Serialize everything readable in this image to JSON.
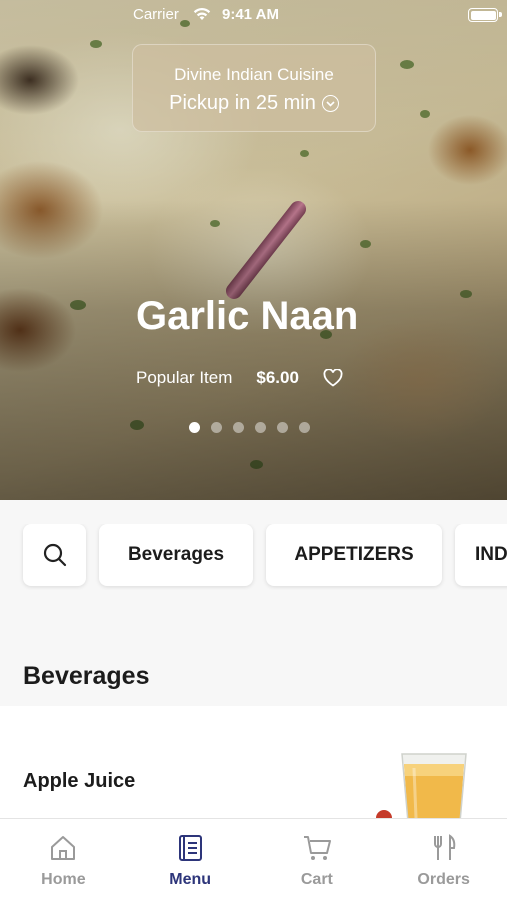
{
  "status_bar": {
    "carrier": "Carrier",
    "time": "9:41 AM"
  },
  "header": {
    "restaurant": "Divine Indian Cuisine",
    "pickup": "Pickup in 25 min"
  },
  "hero": {
    "item_title": "Garlic Naan",
    "tag": "Popular Item",
    "price": "$6.00",
    "slides": 6,
    "active_slide": 1
  },
  "categories": [
    "Beverages",
    "APPETIZERS",
    "IND"
  ],
  "section": {
    "title": "Beverages"
  },
  "menu_items": [
    {
      "name": "Apple Juice"
    }
  ],
  "tabs": [
    {
      "label": "Home",
      "icon": "home-icon",
      "active": false
    },
    {
      "label": "Menu",
      "icon": "menu-book-icon",
      "active": true
    },
    {
      "label": "Cart",
      "icon": "cart-icon",
      "active": false
    },
    {
      "label": "Orders",
      "icon": "fork-knife-icon",
      "active": false
    }
  ],
  "colors": {
    "accent": "#2d357a",
    "inactive": "#9a9a9a",
    "background": "#f7f7f7"
  }
}
